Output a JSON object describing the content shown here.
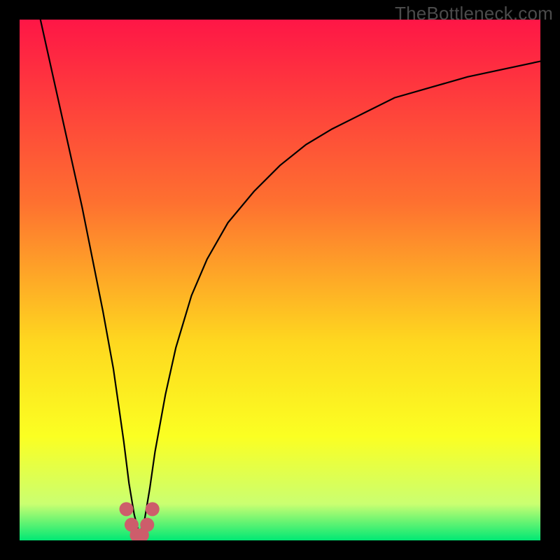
{
  "watermark": "TheBottleneck.com",
  "colors": {
    "frame": "#000000",
    "gradient_top": "#fe1646",
    "gradient_mid1": "#fe7030",
    "gradient_mid2": "#fed81f",
    "gradient_mid3": "#fbff22",
    "gradient_mid4": "#caff71",
    "gradient_bottom": "#00e874",
    "curve": "#010101",
    "marker": "#cd5d6b"
  },
  "chart_data": {
    "type": "line",
    "title": "",
    "xlabel": "",
    "ylabel": "",
    "xlim": [
      0,
      100
    ],
    "ylim": [
      0,
      100
    ],
    "x_min_point": 23,
    "series": [
      {
        "name": "bottleneck-curve",
        "x": [
          4,
          6,
          8,
          10,
          12,
          14,
          16,
          18,
          20,
          21,
          22,
          23,
          24,
          25,
          26,
          28,
          30,
          33,
          36,
          40,
          45,
          50,
          55,
          60,
          66,
          72,
          79,
          86,
          93,
          100
        ],
        "y": [
          100,
          91,
          82,
          73,
          64,
          54,
          44,
          33,
          19,
          11,
          5,
          1,
          4,
          10,
          17,
          28,
          37,
          47,
          54,
          61,
          67,
          72,
          76,
          79,
          82,
          85,
          87,
          89,
          90.5,
          92
        ]
      }
    ],
    "markers": {
      "name": "highlight-points",
      "x": [
        20.5,
        21.5,
        22.5,
        23.5,
        24.5,
        25.5
      ],
      "y": [
        6,
        3,
        1,
        1,
        3,
        6
      ]
    }
  }
}
